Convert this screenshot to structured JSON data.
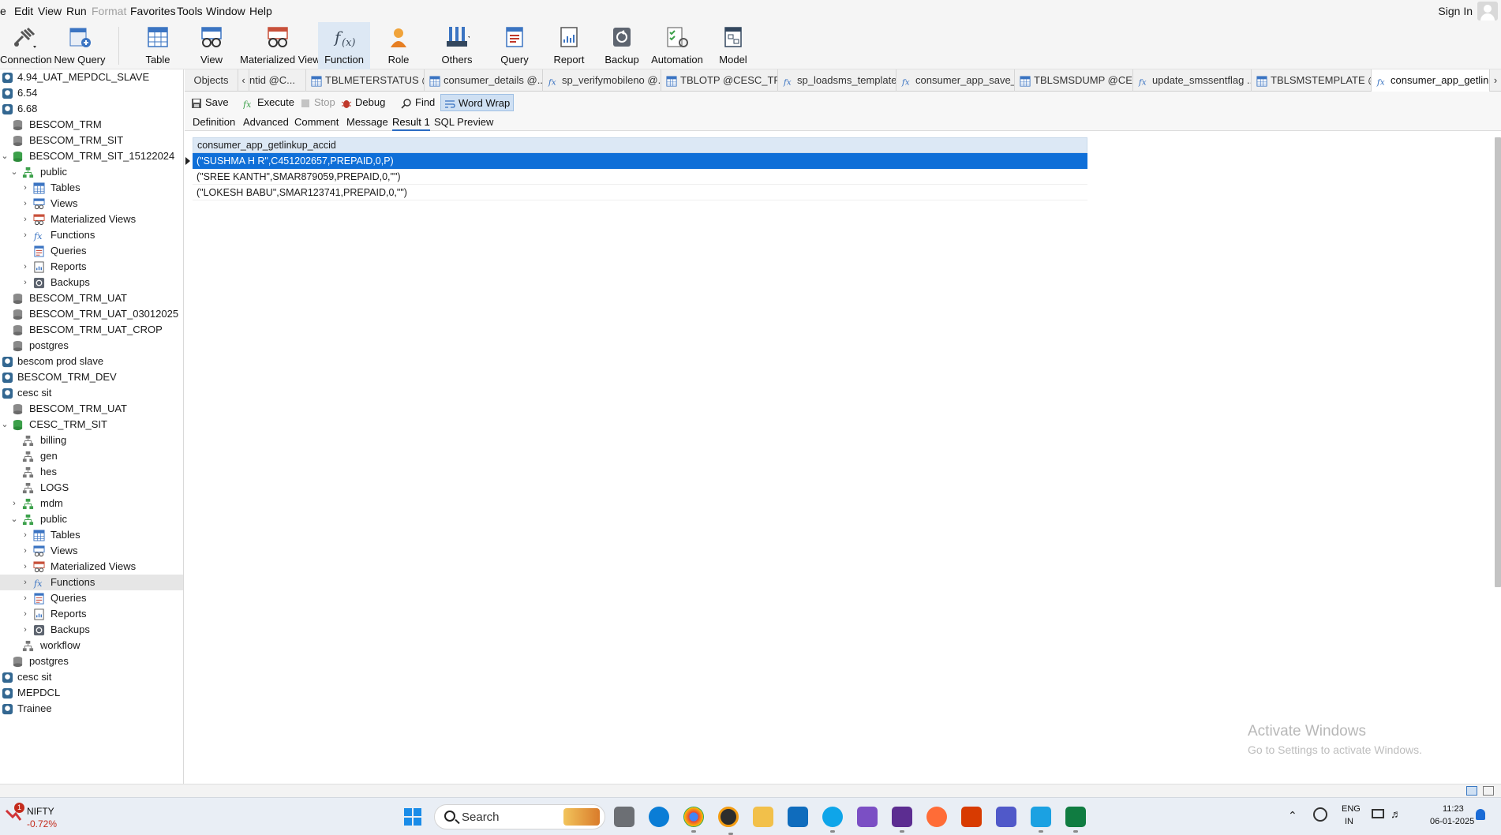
{
  "menu": [
    "e",
    "Edit",
    "View",
    "Run",
    "Format",
    "Favorites",
    "Tools",
    "Window",
    "Help"
  ],
  "sign_in": "Sign In",
  "toolbar": {
    "connection": "Connection",
    "new_query": "New Query",
    "table": "Table",
    "view": "View",
    "materialized_view": "Materialized View",
    "function": "Function",
    "role": "Role",
    "others": "Others",
    "query": "Query",
    "report": "Report",
    "backup": "Backup",
    "automation": "Automation",
    "model": "Model"
  },
  "nav": [
    "4.94_UAT_MEPDCL_SLAVE",
    "6.54",
    "6.68",
    "BESCOM_TRM",
    "BESCOM_TRM_SIT",
    "BESCOM_TRM_SIT_15122024",
    "public",
    "Tables",
    "Views",
    "Materialized Views",
    "Functions",
    "Queries",
    "Reports",
    "Backups",
    "BESCOM_TRM_UAT",
    "BESCOM_TRM_UAT_03012025",
    "BESCOM_TRM_UAT_CROP",
    "postgres",
    "bescom prod slave",
    "BESCOM_TRM_DEV",
    "cesc sit",
    "BESCOM_TRM_UAT",
    "CESC_TRM_SIT",
    "billing",
    "gen",
    "hes",
    "LOGS",
    "mdm",
    "public",
    "Tables",
    "Views",
    "Materialized Views",
    "Functions",
    "Queries",
    "Reports",
    "Backups",
    "workflow",
    "postgres",
    "cesc sit",
    "MEPDCL",
    "Trainee"
  ],
  "tabs": [
    "Objects",
    "ntid @C...",
    "TBLMETERSTATUS @...",
    "consumer_details @...",
    "sp_verifymobileno @...",
    "TBLOTP @CESC_TRM...",
    "sp_loadsms_template...",
    "consumer_app_save_...",
    "TBLSMSDUMP @CES...",
    "update_smssentflag ...",
    "TBLSMSTEMPLATE @...",
    "consumer_app_getlin..."
  ],
  "editor_toolbar": {
    "save": "Save",
    "execute": "Execute",
    "stop": "Stop",
    "debug": "Debug",
    "find": "Find",
    "word_wrap": "Word Wrap"
  },
  "sub_tabs": [
    "Definition",
    "Advanced",
    "Comment",
    "Message",
    "Result 1",
    "SQL Preview"
  ],
  "result": {
    "column": "consumer_app_getlinkup_accid",
    "rows": [
      "(\"SUSHMA H R\",C451202657,PREPAID,0,P)",
      "(\"SREE KANTH\",SMAR879059,PREPAID,0,\"\")",
      "(\"LOKESH BABU\",SMAR123741,PREPAID,0,\"\")"
    ]
  },
  "watermark": {
    "title": "Activate Windows",
    "subtitle": "Go to Settings to activate Windows."
  },
  "taskbar": {
    "stock_name": "NIFTY",
    "stock_change": "-0.72%",
    "badge": "1",
    "search": "Search",
    "lang_top": "ENG",
    "lang_bottom": "IN",
    "time": "11:23",
    "date": "06-01-2025"
  },
  "colors": {
    "accent": "#0f6fd8",
    "header": "#dce8f5",
    "db_green": "#3ca04a"
  }
}
